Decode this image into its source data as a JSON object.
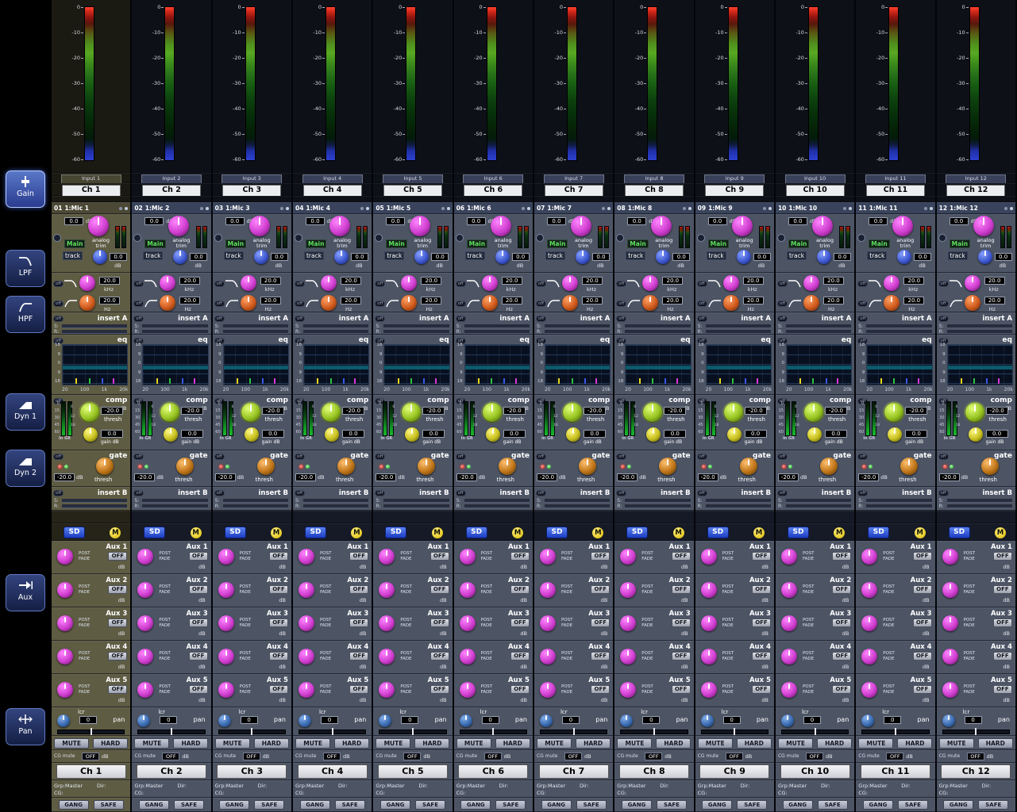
{
  "sidebar": {
    "buttons": [
      {
        "label": "Gain",
        "icon": "gain-fader-icon",
        "active": true
      },
      {
        "label": "LPF",
        "icon": "lpf-curve-icon"
      },
      {
        "label": "HPF",
        "icon": "hpf-curve-icon"
      },
      {
        "label": "Dyn 1",
        "icon": "dynamics-curve-icon"
      },
      {
        "label": "Dyn 2",
        "icon": "dynamics-curve-icon"
      },
      {
        "label": "Aux",
        "icon": "aux-send-icon"
      },
      {
        "label": "Pan",
        "icon": "pan-icon"
      }
    ]
  },
  "strings": {
    "meter_scale": [
      "0",
      "-10",
      "-20",
      "-30",
      "-40",
      "-50",
      "-60"
    ],
    "gain_value": "0.0",
    "db": "dB",
    "analog": "analog",
    "trim": "trim",
    "main": "Main",
    "track": "track",
    "trim_value": "0.0",
    "off": "off",
    "lpf_value": "20.0",
    "khz": "kHz",
    "hpf_value": "20.0",
    "hz": "Hz",
    "insert_a": "insert A",
    "insert_b": "insert B",
    "send": "S:",
    "ret": "R:",
    "eq": "eq",
    "eq_scale": [
      "18",
      "9",
      "0",
      "9",
      "18"
    ],
    "eq_freqs": [
      "20",
      "100",
      "1k",
      "20k"
    ],
    "comp": "comp",
    "comp_scale": [
      "0",
      "15",
      "30",
      "45",
      "60"
    ],
    "comp_gr_scale": [
      "6",
      "12",
      "18"
    ],
    "in_gr": "in GR",
    "thresh": "thresh",
    "comp_thresh_value": "-20.0",
    "comp_gain_value": "0.0",
    "gain_db_label": "gain dB",
    "gate": "gate",
    "gate_thresh_value": "-20.0",
    "sd": "SD",
    "m": "M",
    "aux_labels": [
      "Aux 1",
      "Aux 2",
      "Aux 3",
      "Aux 4",
      "Aux 5"
    ],
    "post": "POST",
    "fade": "FADE",
    "off_btn": "OFF",
    "lcr": "lcr",
    "pan_value": "0",
    "pan": "pan",
    "mute": "MUTE",
    "hard": "HARD",
    "cg_mute": "CG mute",
    "cg_off": "OFF",
    "grp_master": "Grp:Master",
    "dir": "Dir:",
    "cg": "CG:",
    "gang": "GANG",
    "safe": "SAFE"
  },
  "colors": {
    "sd_button_blue": "#2a52cc",
    "mute_group_yellow": "#e0c020",
    "aux_knob_magenta": "#cf3ecf",
    "comp_knob_green": "#95c220",
    "hpf_knob_orange": "#cf5a1c",
    "selected_strip_olive": "#5e5c43",
    "strip_blue_gray": "#4d5565"
  },
  "channels": [
    {
      "input": "Input 1",
      "name": "Ch 1",
      "num": "01",
      "source": "1:Mic 1",
      "selected": true
    },
    {
      "input": "Input 2",
      "name": "Ch 2",
      "num": "02",
      "source": "1:Mic 2"
    },
    {
      "input": "Input 3",
      "name": "Ch 3",
      "num": "03",
      "source": "1:Mic 3"
    },
    {
      "input": "Input 4",
      "name": "Ch 4",
      "num": "04",
      "source": "1:Mic 4"
    },
    {
      "input": "Input 5",
      "name": "Ch 5",
      "num": "05",
      "source": "1:Mic 5"
    },
    {
      "input": "Input 6",
      "name": "Ch 6",
      "num": "06",
      "source": "1:Mic 6"
    },
    {
      "input": "Input 7",
      "name": "Ch 7",
      "num": "07",
      "source": "1:Mic 7"
    },
    {
      "input": "Input 8",
      "name": "Ch 8",
      "num": "08",
      "source": "1:Mic 8"
    },
    {
      "input": "Input 9",
      "name": "Ch 9",
      "num": "09",
      "source": "1:Mic 9"
    },
    {
      "input": "Input 10",
      "name": "Ch 10",
      "num": "10",
      "source": "1:Mic 10"
    },
    {
      "input": "Input 11",
      "name": "Ch 11",
      "num": "11",
      "source": "1:Mic 11"
    },
    {
      "input": "Input 12",
      "name": "Ch 12",
      "num": "12",
      "source": "1:Mic 12"
    }
  ]
}
